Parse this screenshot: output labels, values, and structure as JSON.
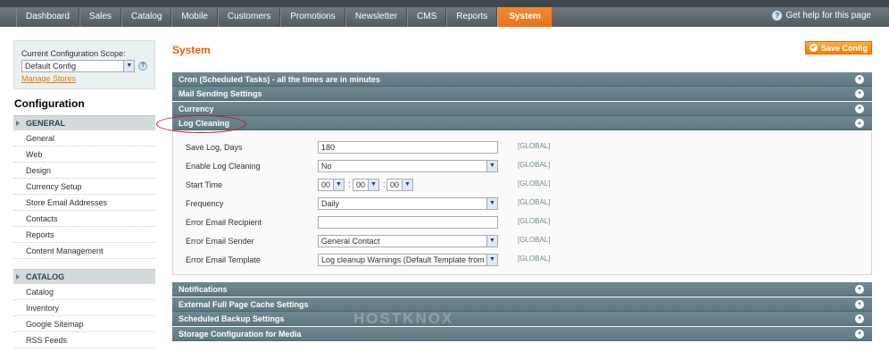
{
  "nav": {
    "items": [
      "Dashboard",
      "Sales",
      "Catalog",
      "Mobile",
      "Customers",
      "Promotions",
      "Newsletter",
      "CMS",
      "Reports",
      "System"
    ],
    "active": "System",
    "help": "Get help for this page"
  },
  "scope": {
    "label": "Current Configuration Scope:",
    "value": "Default Config",
    "manage": "Manage Stores"
  },
  "sidebar": {
    "title": "Configuration",
    "groups": [
      {
        "name": "GENERAL",
        "items": [
          "General",
          "Web",
          "Design",
          "Currency Setup",
          "Store Email Addresses",
          "Contacts",
          "Reports",
          "Content Management"
        ]
      },
      {
        "name": "CATALOG",
        "items": [
          "Catalog",
          "Inventory",
          "Google Sitemap",
          "RSS Feeds"
        ]
      }
    ]
  },
  "main": {
    "title": "System",
    "save_label": "Save Config",
    "sections_top": [
      "Cron (Scheduled Tasks) - all the times are in minutes",
      "Mail Sending Settings",
      "Currency",
      "Log Cleaning"
    ],
    "fields": [
      {
        "label": "Save Log, Days",
        "value": "180",
        "scope": "[GLOBAL]"
      },
      {
        "label": "Enable Log Cleaning",
        "value": "No",
        "scope": "[GLOBAL]"
      },
      {
        "label": "Start Time",
        "hour": "00",
        "minute": "00",
        "second": "00",
        "scope": "[GLOBAL]"
      },
      {
        "label": "Frequency",
        "value": "Daily",
        "scope": "[GLOBAL]"
      },
      {
        "label": "Error Email Recipient",
        "value": "",
        "scope": "[GLOBAL]"
      },
      {
        "label": "Error Email Sender",
        "value": "General Contact",
        "scope": "[GLOBAL]"
      },
      {
        "label": "Error Email Template",
        "value": "Log cleanup Warnings (Default Template from Loc",
        "scope": "[GLOBAL]"
      }
    ],
    "sections_bottom": [
      "Notifications",
      "External Full Page Cache Settings",
      "Scheduled Backup Settings",
      "Storage Configuration for Media"
    ]
  },
  "watermark": "HOSTKNOX",
  "colors": {
    "accent": "#eb5e00",
    "section_header": "#6f8992",
    "nav_bg": "#505b60"
  }
}
